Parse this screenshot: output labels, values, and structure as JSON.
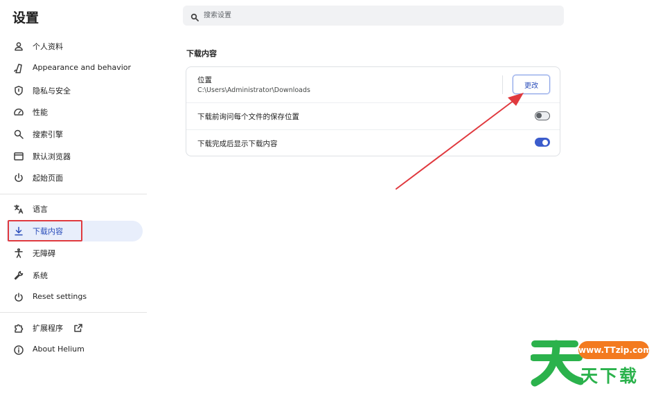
{
  "app": {
    "title": "设置"
  },
  "search": {
    "placeholder": "搜索设置",
    "value": ""
  },
  "sidebar": {
    "items": [
      {
        "label": "个人资料",
        "icon": "person-icon"
      },
      {
        "label": "Appearance and behavior",
        "icon": "paint-icon"
      },
      {
        "label": "隐私与安全",
        "icon": "shield-icon"
      },
      {
        "label": "性能",
        "icon": "speedometer-icon"
      },
      {
        "label": "搜索引擎",
        "icon": "search-icon"
      },
      {
        "label": "默认浏览器",
        "icon": "browser-window-icon"
      },
      {
        "label": "起始页面",
        "icon": "power-icon"
      },
      {
        "label": "语言",
        "icon": "translate-icon"
      },
      {
        "label": "下载内容",
        "icon": "download-icon",
        "selected": true
      },
      {
        "label": "无障碍",
        "icon": "accessibility-icon"
      },
      {
        "label": "系统",
        "icon": "wrench-icon"
      },
      {
        "label": "Reset settings",
        "icon": "reset-icon"
      },
      {
        "label": "扩展程序",
        "icon": "puzzle-icon",
        "external": "external-link-icon"
      },
      {
        "label": "About Helium",
        "icon": "info-icon"
      }
    ]
  },
  "downloads": {
    "section_title": "下载内容",
    "location": {
      "label": "位置",
      "path": "C:\\Users\\Administrator\\Downloads",
      "button_label": "更改"
    },
    "ask_where": {
      "label": "下载前询问每个文件的保存位置",
      "enabled": false
    },
    "show_when_done": {
      "label": "下载完成后显示下载内容",
      "enabled": true
    }
  },
  "colors": {
    "accent": "#2a4dba",
    "selected_bg": "#e8eefb",
    "annotation_red": "#e0393e",
    "toggle_on": "#3b5ccc"
  },
  "watermark": {
    "logo_char": "天",
    "url": "www.TTzip.com",
    "text": "天下载"
  }
}
